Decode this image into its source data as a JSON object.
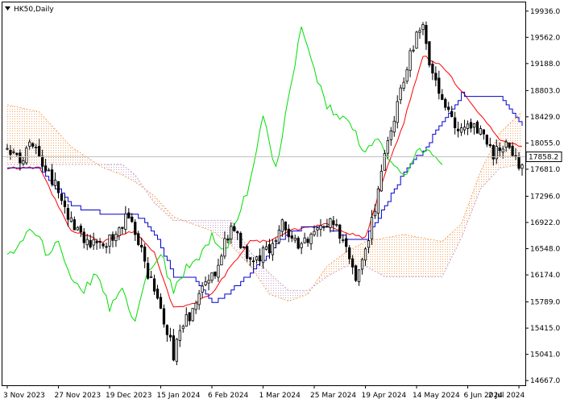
{
  "chart_title": "HK50,Daily",
  "colors": {
    "background": "#ffffff",
    "frame": "#000000",
    "candle": "#000000",
    "tenkan": "#ff0000",
    "kijun": "#0000cc",
    "chikou": "#00dd00",
    "cloud_bullish": "#f4a460",
    "cloud_bearish": "#c8a2c8",
    "current_price_line": "#c0c0c0"
  },
  "chart_data": {
    "type": "candlestick",
    "title": "HK50,Daily",
    "indicator": "Ichimoku",
    "y_axis": {
      "ticks": [
        14667.0,
        15041.0,
        15415.0,
        15789.0,
        16174.0,
        16548.0,
        16922.0,
        17296.0,
        17681.0,
        18055.0,
        18429.0,
        18803.0,
        19188.0,
        19562.0,
        19936.0
      ],
      "labels": [
        "14667.0",
        "15041.0",
        "15415.0",
        "15789.0",
        "16174.0",
        "16548.0",
        "16922.0",
        "17296.0",
        "17681.0",
        "18055.0",
        "18429.0",
        "18803.0",
        "19188.0",
        "19562.0",
        "19936.0"
      ],
      "ylim": [
        14600,
        20060
      ]
    },
    "x_axis": {
      "labels": [
        "3 Nov 2023",
        "27 Nov 2023",
        "19 Dec 2023",
        "15 Jan 2024",
        "6 Feb 2024",
        "1 Mar 2024",
        "25 Mar 2024",
        "19 Apr 2024",
        "14 May 2024",
        "6 Jun 2024",
        "2 Jul 2024"
      ],
      "label_bar_index": [
        0,
        16,
        32,
        48,
        64,
        80,
        96,
        112,
        128,
        144,
        160
      ],
      "bars_visible": 162
    },
    "current_price": {
      "value": 17858.2,
      "label": "17858.2"
    },
    "price_path": [
      [
        0,
        17950
      ],
      [
        4,
        17780
      ],
      [
        8,
        18050
      ],
      [
        12,
        17700
      ],
      [
        16,
        17350
      ],
      [
        20,
        16920
      ],
      [
        24,
        16650
      ],
      [
        28,
        16580
      ],
      [
        32,
        16680
      ],
      [
        35,
        16850
      ],
      [
        38,
        17050
      ],
      [
        41,
        16650
      ],
      [
        44,
        16180
      ],
      [
        47,
        15820
      ],
      [
        50,
        15350
      ],
      [
        52,
        15050
      ],
      [
        54,
        15420
      ],
      [
        58,
        15650
      ],
      [
        62,
        16020
      ],
      [
        66,
        16320
      ],
      [
        70,
        16900
      ],
      [
        74,
        16500
      ],
      [
        78,
        16420
      ],
      [
        82,
        16550
      ],
      [
        86,
        16950
      ],
      [
        89,
        16700
      ],
      [
        92,
        16550
      ],
      [
        96,
        16800
      ],
      [
        100,
        16920
      ],
      [
        103,
        16880
      ],
      [
        106,
        16560
      ],
      [
        109,
        16180
      ],
      [
        111,
        16400
      ],
      [
        113,
        16720
      ],
      [
        116,
        17350
      ],
      [
        119,
        18050
      ],
      [
        122,
        18580
      ],
      [
        125,
        19150
      ],
      [
        128,
        19600
      ],
      [
        130,
        19750
      ],
      [
        132,
        19250
      ],
      [
        135,
        18850
      ],
      [
        138,
        18550
      ],
      [
        141,
        18250
      ],
      [
        144,
        18380
      ],
      [
        148,
        18220
      ],
      [
        152,
        17900
      ],
      [
        156,
        18050
      ],
      [
        159,
        17850
      ],
      [
        161,
        17700
      ]
    ],
    "series": [
      {
        "name": "Tenkan-sen",
        "color": "#ff0000",
        "x": [
          0,
          10,
          20,
          30,
          40,
          46,
          52,
          58,
          64,
          70,
          76,
          82,
          88,
          94,
          100,
          106,
          112,
          118,
          124,
          130,
          136,
          142,
          148,
          154,
          161
        ],
        "values": [
          17700,
          17700,
          16800,
          16650,
          16800,
          16480,
          15700,
          15750,
          15900,
          16300,
          16650,
          16650,
          16800,
          16850,
          16900,
          16780,
          16700,
          17600,
          18350,
          19300,
          19150,
          18800,
          18450,
          18100,
          18000
        ]
      },
      {
        "name": "Kijun-sen",
        "color": "#0000cc",
        "x": [
          0,
          10,
          20,
          30,
          40,
          46,
          52,
          58,
          64,
          70,
          76,
          82,
          88,
          94,
          100,
          106,
          112,
          118,
          124,
          130,
          136,
          142,
          148,
          154,
          161
        ],
        "values": [
          17700,
          17700,
          17150,
          17050,
          17050,
          16750,
          16150,
          16150,
          15750,
          15950,
          16200,
          16500,
          16800,
          16850,
          16850,
          16700,
          16700,
          17150,
          17650,
          17950,
          18350,
          18750,
          18700,
          18700,
          18300
        ]
      },
      {
        "name": "Chikou Span",
        "color": "#00dd00",
        "x": [
          0,
          4,
          8,
          12,
          16,
          20,
          24,
          28,
          32,
          36,
          40,
          44,
          48,
          52,
          56,
          60,
          64,
          68,
          72,
          76,
          80,
          84,
          88,
          92,
          96,
          100,
          104,
          108,
          112,
          116,
          120,
          124,
          128,
          132,
          136
        ],
        "values": [
          16400,
          16600,
          16850,
          16500,
          16600,
          16100,
          15950,
          16200,
          15700,
          16000,
          15500,
          16200,
          16500,
          15900,
          16300,
          16400,
          16750,
          16500,
          16950,
          17500,
          18400,
          17700,
          18700,
          19700,
          19100,
          18600,
          18400,
          18300,
          17900,
          18100,
          17800,
          17600,
          17900,
          18000,
          17700
        ]
      },
      {
        "name": "Senkou Span A",
        "color": "#f4a460",
        "x": [
          0,
          10,
          20,
          30,
          36,
          40,
          46,
          52,
          58,
          64,
          70,
          76,
          82,
          88,
          94,
          100,
          106,
          112,
          118,
          124,
          130,
          136,
          142,
          148,
          154,
          161
        ],
        "values": [
          18600,
          18500,
          18000,
          17700,
          17600,
          17500,
          17300,
          17000,
          16900,
          16800,
          16600,
          16300,
          15900,
          15800,
          15900,
          16300,
          16500,
          16650,
          16700,
          16750,
          16700,
          16650,
          16900,
          17650,
          18200,
          18500
        ]
      },
      {
        "name": "Senkou Span B",
        "color": "#c8a2c8",
        "x": [
          0,
          10,
          20,
          30,
          36,
          40,
          46,
          52,
          58,
          64,
          70,
          76,
          82,
          88,
          94,
          100,
          106,
          112,
          118,
          124,
          130,
          136,
          142,
          148,
          154,
          161
        ],
        "values": [
          17750,
          17750,
          17750,
          17750,
          17750,
          17600,
          17200,
          16950,
          16950,
          16950,
          16950,
          16500,
          16200,
          15950,
          15950,
          16150,
          16300,
          16300,
          16150,
          16150,
          16150,
          16150,
          16700,
          17400,
          17700,
          17750
        ]
      }
    ],
    "grid": false,
    "legend": "none"
  }
}
